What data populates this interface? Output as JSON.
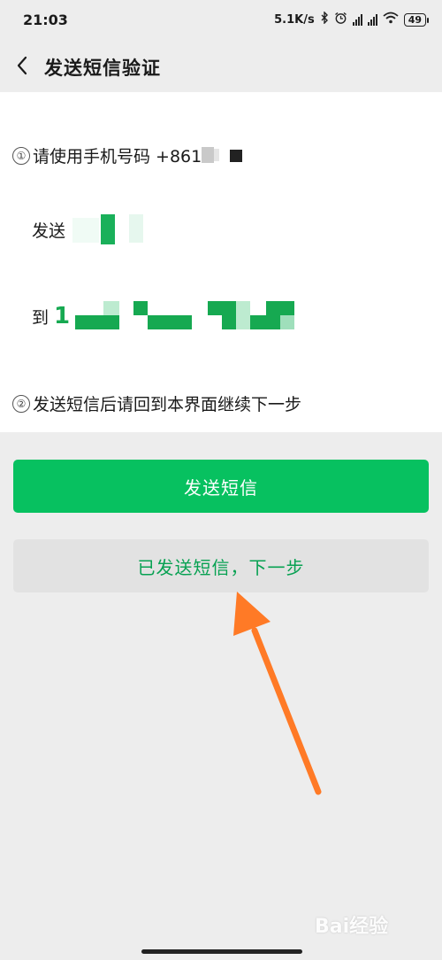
{
  "status_bar": {
    "time": "21:03",
    "speed": "5.1K/s",
    "battery": "49"
  },
  "header": {
    "title": "发送短信验证",
    "back_icon": "chevron-left-icon"
  },
  "steps": {
    "step1_num": "①",
    "step1_text": "请使用手机号码 +861",
    "send_label": "发送",
    "to_label": "到",
    "to_prefix": "1",
    "step2_num": "②",
    "step2_text": "发送短信后请回到本界面继续下一步"
  },
  "buttons": {
    "send_sms": "发送短信",
    "sent_next": "已发送短信，下一步"
  },
  "watermark": "Bai经验",
  "colors": {
    "primary": "#07c160",
    "secondary_text": "#07a152",
    "annotation": "#ff7a26"
  }
}
